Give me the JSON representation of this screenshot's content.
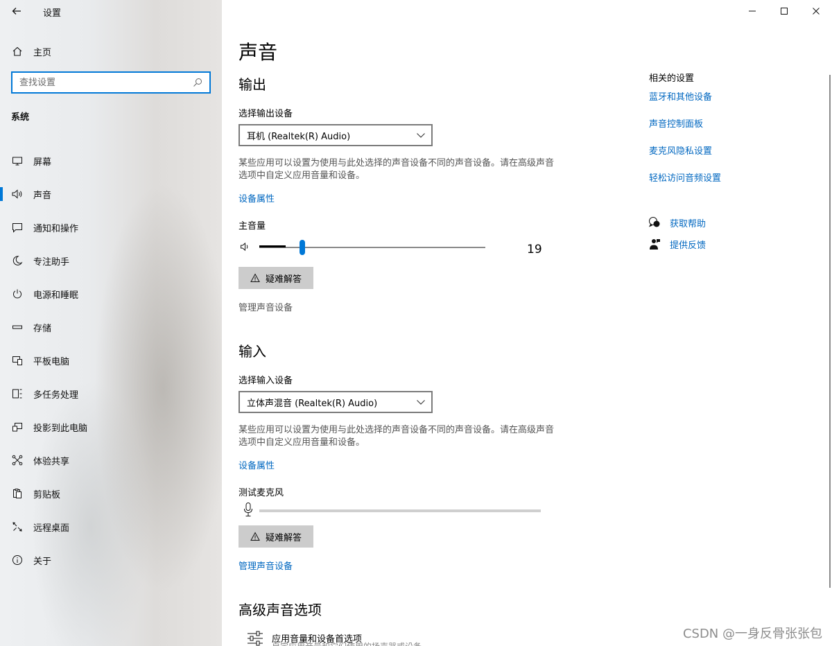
{
  "titlebar": {
    "title": "设置"
  },
  "sidebar": {
    "home_label": "主页",
    "search_placeholder": "查找设置",
    "section_label": "系统",
    "items": [
      {
        "label": "屏幕",
        "icon": "monitor-icon"
      },
      {
        "label": "声音",
        "icon": "speaker-icon",
        "active": true
      },
      {
        "label": "通知和操作",
        "icon": "notification-icon"
      },
      {
        "label": "专注助手",
        "icon": "moon-icon"
      },
      {
        "label": "电源和睡眠",
        "icon": "power-icon"
      },
      {
        "label": "存储",
        "icon": "storage-icon"
      },
      {
        "label": "平板电脑",
        "icon": "tablet-icon"
      },
      {
        "label": "多任务处理",
        "icon": "multitask-icon"
      },
      {
        "label": "投影到此电脑",
        "icon": "project-icon"
      },
      {
        "label": "体验共享",
        "icon": "share-icon"
      },
      {
        "label": "剪贴板",
        "icon": "clipboard-icon"
      },
      {
        "label": "远程桌面",
        "icon": "remote-icon"
      },
      {
        "label": "关于",
        "icon": "info-icon"
      }
    ]
  },
  "main": {
    "title": "声音",
    "output": {
      "heading": "输出",
      "device_label": "选择输出设备",
      "device_value": "耳机 (Realtek(R) Audio)",
      "description": "某些应用可以设置为使用与此处选择的声音设备不同的声音设备。请在高级声音选项中自定义应用音量和设备。",
      "device_props_link": "设备属性",
      "volume_label": "主音量",
      "volume_value": "19",
      "volume_fraction": 0.19,
      "troubleshoot_label": "疑难解答",
      "manage_link": "管理声音设备"
    },
    "input": {
      "heading": "输入",
      "device_label": "选择输入设备",
      "device_value": "立体声混音 (Realtek(R) Audio)",
      "description": "某些应用可以设置为使用与此处选择的声音设备不同的声音设备。请在高级声音选项中自定义应用音量和设备。",
      "device_props_link": "设备属性",
      "test_mic_label": "测试麦克风",
      "troubleshoot_label": "疑难解答",
      "manage_link": "管理声音设备"
    },
    "advanced": {
      "heading": "高级声音选项",
      "app_volume_label": "应用音量和设备首选项",
      "app_volume_sub": "自定应用音量和它们使用的扬声器或设备。"
    }
  },
  "related": {
    "title": "相关的设置",
    "links": [
      "蓝牙和其他设备",
      "声音控制面板",
      "麦克风隐私设置",
      "轻松访问音频设置"
    ],
    "help_label": "获取帮助",
    "feedback_label": "提供反馈"
  },
  "watermark": "CSDN @一身反骨张张包",
  "colors": {
    "accent": "#0078d7",
    "link": "#0067c0"
  }
}
